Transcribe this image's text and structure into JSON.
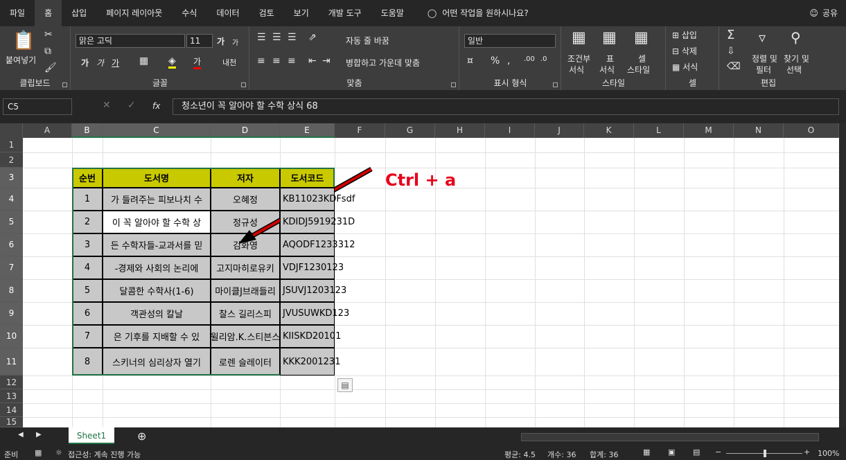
{
  "tabs": [
    "파일",
    "홈",
    "삽입",
    "페이지 레이아웃",
    "수식",
    "데이터",
    "검토",
    "보기",
    "개발 도구",
    "도움말"
  ],
  "tell_me": "어떤 작업을 원하시나요?",
  "share": "공유",
  "ribbon": {
    "clipboard": {
      "label": "클립보드",
      "paste": "붙여넣기"
    },
    "font": {
      "label": "글꼴",
      "name": "맑은 고딕",
      "size": "11",
      "bold": "가",
      "italic": "가",
      "underline": "가",
      "grow": "가",
      "shrink": "가",
      "color": "가",
      "phonetic": "내천"
    },
    "align": {
      "label": "맞춤",
      "wrap": "자동 줄 바꿈",
      "merge": "병합하고 가운데 맞춤"
    },
    "number": {
      "label": "표시 형식",
      "format": "일반"
    },
    "styles": {
      "label": "스타일",
      "cond1": "조건부",
      "cond2": "서식",
      "table1": "표",
      "table2": "서식",
      "cell1": "셀",
      "cell2": "스타일"
    },
    "cells": {
      "label": "셀",
      "insert": "삽입",
      "delete": "삭제",
      "format": "서식"
    },
    "edit": {
      "label": "편집",
      "sort1": "정렬 및",
      "sort2": "필터",
      "find1": "찾기 및",
      "find2": "선택"
    }
  },
  "formula_bar": {
    "name_box": "C5",
    "fx": "fx",
    "content": "청소년이 꼭 알아야 할 수학 상식 68"
  },
  "columns": [
    "A",
    "B",
    "C",
    "D",
    "E",
    "F",
    "G",
    "H",
    "I",
    "J",
    "K",
    "L",
    "M",
    "N",
    "O"
  ],
  "rows": [
    "1",
    "2",
    "3",
    "4",
    "5",
    "6",
    "7",
    "8",
    "9",
    "10",
    "11",
    "12",
    "13",
    "14",
    "15"
  ],
  "table": {
    "headers": [
      "순번",
      "도서명",
      "저자",
      "도서코드"
    ],
    "rows": [
      [
        "1",
        "가 들려주는 피보나치 수",
        "오혜정",
        "KB11023KDFsdf"
      ],
      [
        "2",
        "이 꼭 알아야 할 수학 상",
        "정규성",
        "KDIDJ5919231D"
      ],
      [
        "3",
        "든 수학자들-교과서를 믿",
        "김화영",
        "AQODF1233312"
      ],
      [
        "4",
        "-경제와 사회의 논리에",
        "고지마히로유키",
        "VDJF1230123"
      ],
      [
        "5",
        "달콤한 수학사(1-6)",
        "마이클J브래들리",
        "JSUVJ1203123"
      ],
      [
        "6",
        "객관성의 칼날",
        "찰스 길리스피",
        "JVUSUWKD123"
      ],
      [
        "7",
        "은 기후를 지배할 수 있",
        "윌리암.K.스티븐스",
        "KIISKD20101"
      ],
      [
        "8",
        "스키너의 심리상자 열기",
        "로렌 슬레이터",
        "KKK2001231"
      ]
    ]
  },
  "annotation": {
    "text": "Ctrl + a",
    "color": "#e8001c"
  },
  "sheet_tab": "Sheet1",
  "status": {
    "ready": "준비",
    "access": "접근성: 계속 진행 가능",
    "avg": "평균: 4.5",
    "count": "개수: 36",
    "sum": "합계: 36",
    "zoom": "100%"
  }
}
